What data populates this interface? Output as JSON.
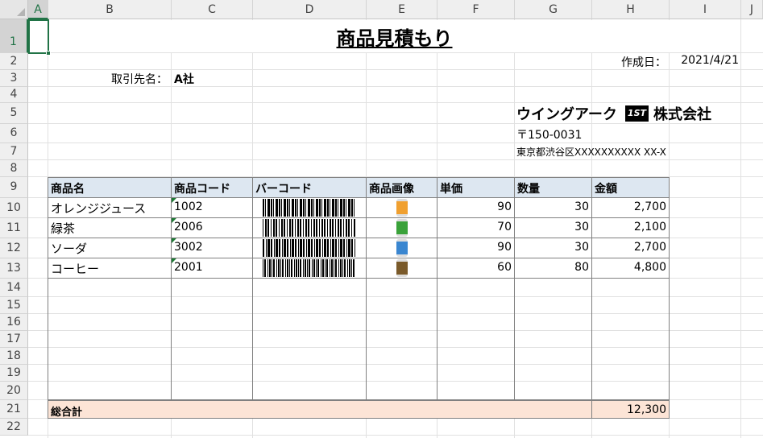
{
  "columns": [
    "A",
    "B",
    "C",
    "D",
    "E",
    "F",
    "G",
    "H",
    "I",
    "J"
  ],
  "rows": [
    "1",
    "2",
    "3",
    "4",
    "5",
    "6",
    "7",
    "8",
    "9",
    "10",
    "11",
    "12",
    "13",
    "14",
    "15",
    "16",
    "17",
    "18",
    "19",
    "20",
    "21",
    "22"
  ],
  "sheet": {
    "title": "商品見積もり",
    "created_label": "作成日：",
    "created_date": "2021/4/21",
    "client_label": "取引先名：",
    "client_value": "A社",
    "company_name": "ウイングアーク",
    "company_logo_text": "1ST",
    "company_suffix": "株式会社",
    "postal": "〒150-0031",
    "address": "東京都渋谷区XXXXXXXXXX XX-X"
  },
  "table": {
    "headers": [
      "商品名",
      "商品コード",
      "バーコード",
      "商品画像",
      "単価",
      "数量",
      "金額"
    ],
    "rows": [
      {
        "name": "オレンジジュース",
        "code": "1002",
        "price": "90",
        "qty": "30",
        "amount": "2,700",
        "icon": "orange-can-icon",
        "color": "#f0a030"
      },
      {
        "name": "緑茶",
        "code": "2006",
        "price": "70",
        "qty": "30",
        "amount": "2,100",
        "icon": "green-tea-can-icon",
        "color": "#3aa23a"
      },
      {
        "name": "ソーダ",
        "code": "3002",
        "price": "90",
        "qty": "30",
        "amount": "2,700",
        "icon": "soda-can-icon",
        "color": "#3a86d0"
      },
      {
        "name": "コーヒー",
        "code": "2001",
        "price": "60",
        "qty": "80",
        "amount": "4,800",
        "icon": "coffee-can-icon",
        "color": "#7a5a2a"
      }
    ],
    "total_label": "総合計",
    "total_value": "12,300"
  }
}
